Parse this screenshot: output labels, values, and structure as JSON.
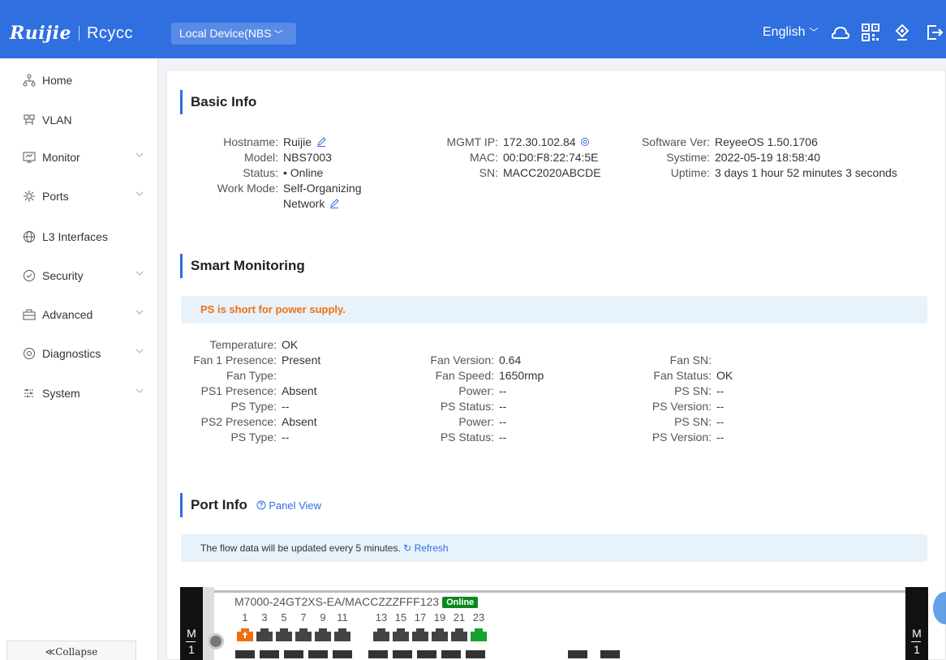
{
  "header": {
    "brand": "Ruijie",
    "brand2": "Rcycc",
    "device": "Local Device(NBS",
    "language": "English"
  },
  "sidebar": {
    "items": [
      {
        "label": "Home",
        "icon": "home-icon"
      },
      {
        "label": "VLAN",
        "icon": "vlan-icon"
      },
      {
        "label": "Monitor",
        "icon": "monitor-icon",
        "expandable": true
      },
      {
        "label": "Ports",
        "icon": "ports-icon",
        "expandable": true
      },
      {
        "label": "L3 Interfaces",
        "icon": "globe-icon"
      },
      {
        "label": "Security",
        "icon": "shield-icon",
        "expandable": true
      },
      {
        "label": "Advanced",
        "icon": "advanced-icon",
        "expandable": true
      },
      {
        "label": "Diagnostics",
        "icon": "diagnostics-icon",
        "expandable": true
      },
      {
        "label": "System",
        "icon": "system-icon",
        "expandable": true
      }
    ],
    "collapse": "≪Collapse"
  },
  "basic": {
    "title": "Basic Info",
    "hostname_k": "Hostname:",
    "hostname": "Ruijie",
    "model_k": "Model:",
    "model": "NBS7003",
    "status_k": "Status:",
    "status": "• Online",
    "workmode_k": "Work Mode:",
    "workmode1": "Self-Organizing",
    "workmode2": "Network",
    "mgmt_k": "MGMT IP:",
    "mgmt": "172.30.102.84",
    "mac_k": "MAC:",
    "mac": "00:D0:F8:22:74:5E",
    "sn_k": "SN:",
    "sn": "MACC2020ABCDE",
    "sw_k": "Software Ver:",
    "sw": "ReyeeOS 1.50.1706",
    "systime_k": "Systime:",
    "systime": "2022-05-19 18:58:40",
    "uptime_k": "Uptime:",
    "uptime": "3 days 1 hour 52 minutes 3 seconds"
  },
  "smart": {
    "title": "Smart Monitoring",
    "banner": "PS is short for power supply.",
    "temperature_k": "Temperature:",
    "temperature": "OK",
    "fan1_k": "Fan 1 Presence:",
    "fan1": "Present",
    "fantype_k": "Fan Type:",
    "fantype": "",
    "ps1_k": "PS1 Presence:",
    "ps1": "Absent",
    "pstype1_k": "PS Type:",
    "pstype1": "--",
    "ps2_k": "PS2 Presence:",
    "ps2": "Absent",
    "pstype2_k": "PS Type:",
    "pstype2": "--",
    "fanver_k": "Fan Version:",
    "fanver": "0.64",
    "fanspeed_k": "Fan Speed:",
    "fanspeed": "1650rmp",
    "power1_k": "Power:",
    "power1": "--",
    "psstatus1_k": "PS Status:",
    "psstatus1": "--",
    "power2_k": "Power:",
    "power2": "--",
    "psstatus2_k": "PS Status:",
    "psstatus2": "--",
    "fansn_k": "Fan SN:",
    "fansn": "",
    "fanstatus_k": "Fan Status:",
    "fanstatus": "OK",
    "pssn1_k": "PS SN:",
    "pssn1": "--",
    "psver1_k": "PS Version:",
    "psver1": "--",
    "pssn2_k": "PS SN:",
    "pssn2": "--",
    "psver2_k": "PS Version:",
    "psver2": "--"
  },
  "port": {
    "title": "Port Info",
    "panel_view": "Panel View",
    "banner": "The flow data will be updated every 5 minutes.",
    "refresh": "Refresh",
    "model": "M7000-24GT2XS-EA/MACCZZZFFF123",
    "online": "Online",
    "m_label": "M",
    "m_num": "1",
    "numbers": [
      "1",
      "3",
      "5",
      "7",
      "9",
      "11",
      "13",
      "15",
      "17",
      "19",
      "21",
      "23"
    ]
  }
}
